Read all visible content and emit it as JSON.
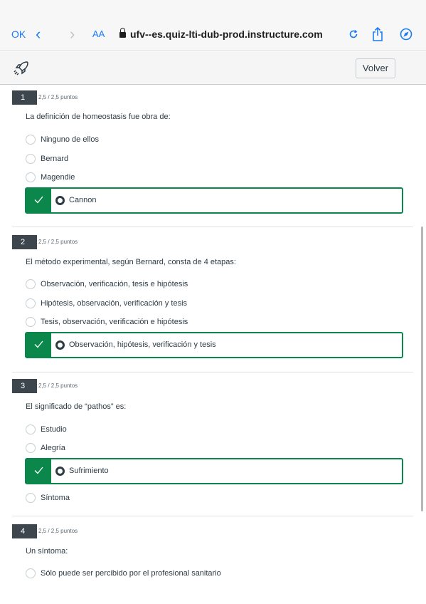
{
  "browser": {
    "ok_label": "OK",
    "back_icon": "‹",
    "forward_icon": "›",
    "text_size_label": "AA",
    "url": "ufv--es.quiz-lti-dub-prod.instructure.com"
  },
  "app_header": {
    "volver_label": "Volver"
  },
  "colors": {
    "correct_green": "#0b874b",
    "badge_dark": "#3d464d",
    "link_blue": "#1a7bf4"
  },
  "questions": [
    {
      "number": "1",
      "points": "2,5 / 2,5 puntos",
      "text": "La definición de homeostasis fue obra de:",
      "answers": [
        "Ninguno de ellos",
        "Bernard",
        "Magendie"
      ],
      "correct": "Cannon"
    },
    {
      "number": "2",
      "points": "2,5 / 2,5 puntos",
      "text": "El método experimental, según Bernard, consta de 4 etapas:",
      "answers": [
        "Observación, verificación, tesis e hipótesis",
        "Hipótesis, observación, verificación y tesis",
        "Tesis, observación, verificación e hipótesis"
      ],
      "correct": "Observación, hipótesis, verificación y tesis"
    },
    {
      "number": "3",
      "points": "2,5 / 2,5 puntos",
      "text": "El significado de “pathos” es:",
      "answers": [
        "Estudio",
        "Alegría",
        "Síntoma"
      ],
      "correct": "Sufrimiento"
    },
    {
      "number": "4",
      "points": "2,5 / 2,5 puntos",
      "text": "Un síntoma:",
      "answers": [
        "Sólo puede ser percibido por el profesional sanitario"
      ]
    }
  ]
}
